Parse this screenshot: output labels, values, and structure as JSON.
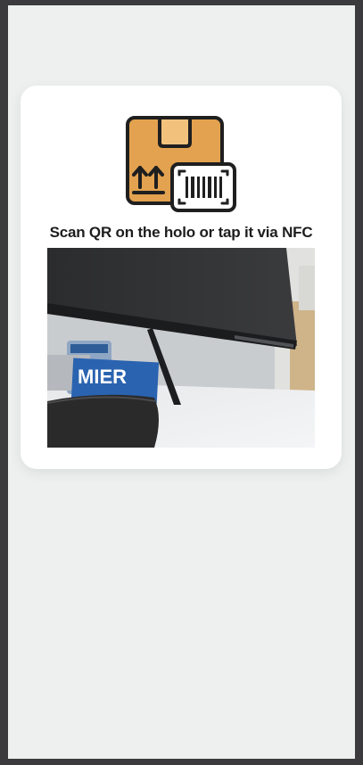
{
  "scan_card": {
    "instruction": "Scan QR on the holo or tap it via NFC",
    "icon": "package-barcode-icon"
  },
  "camera_preview": {
    "label_fragment": "MIER"
  },
  "colors": {
    "background": "#edf0ef",
    "card": "#ffffff",
    "box_orange": "#e3a24f",
    "box_tape": "#f2c27d",
    "outline": "#1f1f1f"
  }
}
